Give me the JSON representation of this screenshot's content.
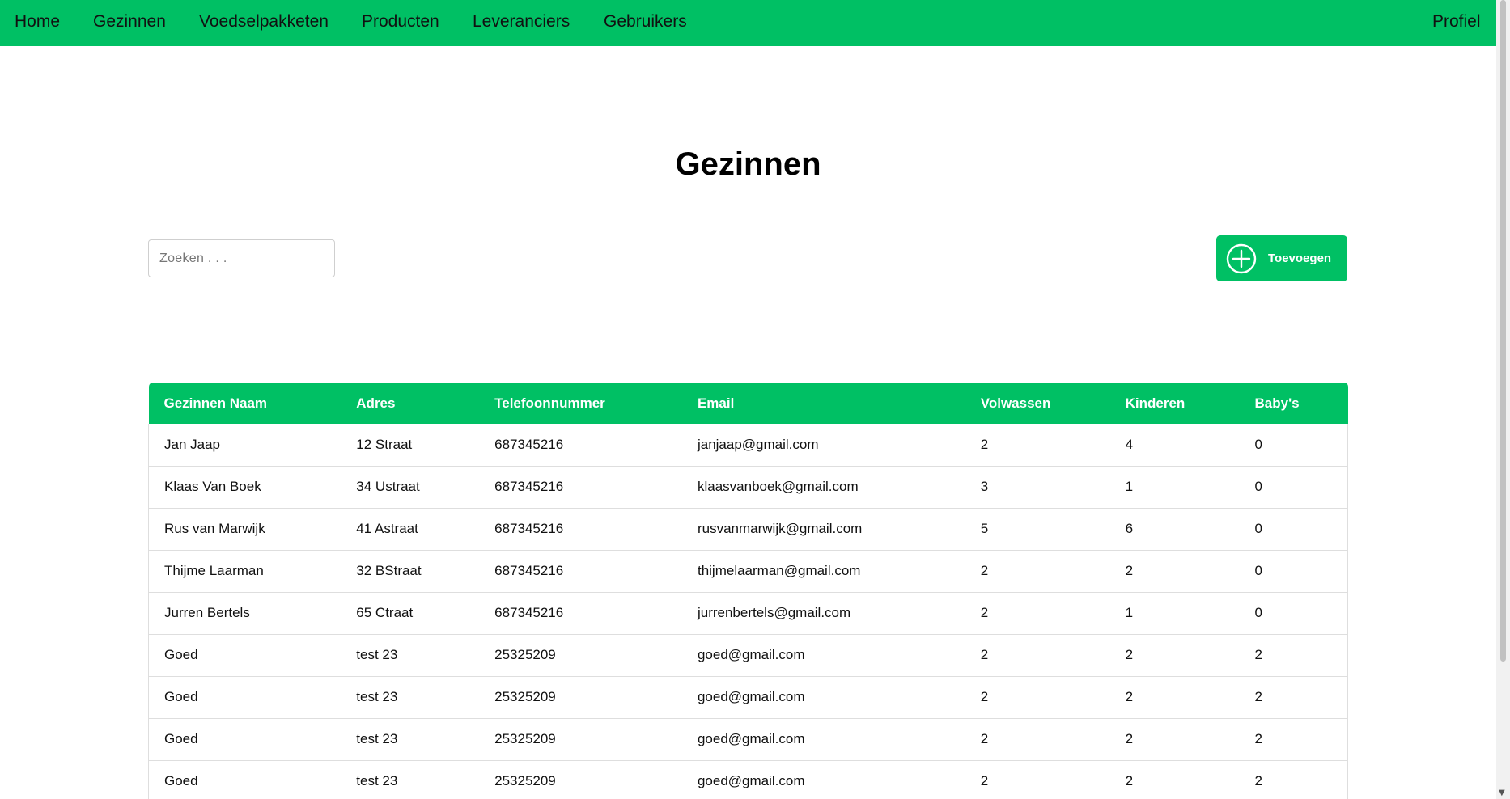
{
  "nav": {
    "home": "Home",
    "gezinnen": "Gezinnen",
    "voedselpakketten": "Voedselpakketen",
    "producten": "Producten",
    "leveranciers": "Leveranciers",
    "gebruikers": "Gebruikers",
    "profiel": "Profiel"
  },
  "page": {
    "title": "Gezinnen"
  },
  "search": {
    "placeholder": "Zoeken . . .",
    "value": ""
  },
  "add_button": {
    "label": "Toevoegen",
    "icon": "plus-circle-icon"
  },
  "colors": {
    "accent": "#00c064",
    "header_text": "#ffffff"
  },
  "table": {
    "headers": [
      "Gezinnen Naam",
      "Adres",
      "Telefoonnummer",
      "Email",
      "Volwassen",
      "Kinderen",
      "Baby's"
    ],
    "rows": [
      [
        "Jan Jaap",
        "12 Straat",
        "687345216",
        "janjaap@gmail.com",
        "2",
        "4",
        "0"
      ],
      [
        "Klaas Van Boek",
        "34 Ustraat",
        "687345216",
        "klaasvanboek@gmail.com",
        "3",
        "1",
        "0"
      ],
      [
        "Rus van Marwijk",
        "41 Astraat",
        "687345216",
        "rusvanmarwijk@gmail.com",
        "5",
        "6",
        "0"
      ],
      [
        "Thijme Laarman",
        "32 BStraat",
        "687345216",
        "thijmelaarman@gmail.com",
        "2",
        "2",
        "0"
      ],
      [
        "Jurren Bertels",
        "65 Ctraat",
        "687345216",
        "jurrenbertels@gmail.com",
        "2",
        "1",
        "0"
      ],
      [
        "Goed",
        "test 23",
        "25325209",
        "goed@gmail.com",
        "2",
        "2",
        "2"
      ],
      [
        "Goed",
        "test 23",
        "25325209",
        "goed@gmail.com",
        "2",
        "2",
        "2"
      ],
      [
        "Goed",
        "test 23",
        "25325209",
        "goed@gmail.com",
        "2",
        "2",
        "2"
      ],
      [
        "Goed",
        "test 23",
        "25325209",
        "goed@gmail.com",
        "2",
        "2",
        "2"
      ]
    ]
  }
}
